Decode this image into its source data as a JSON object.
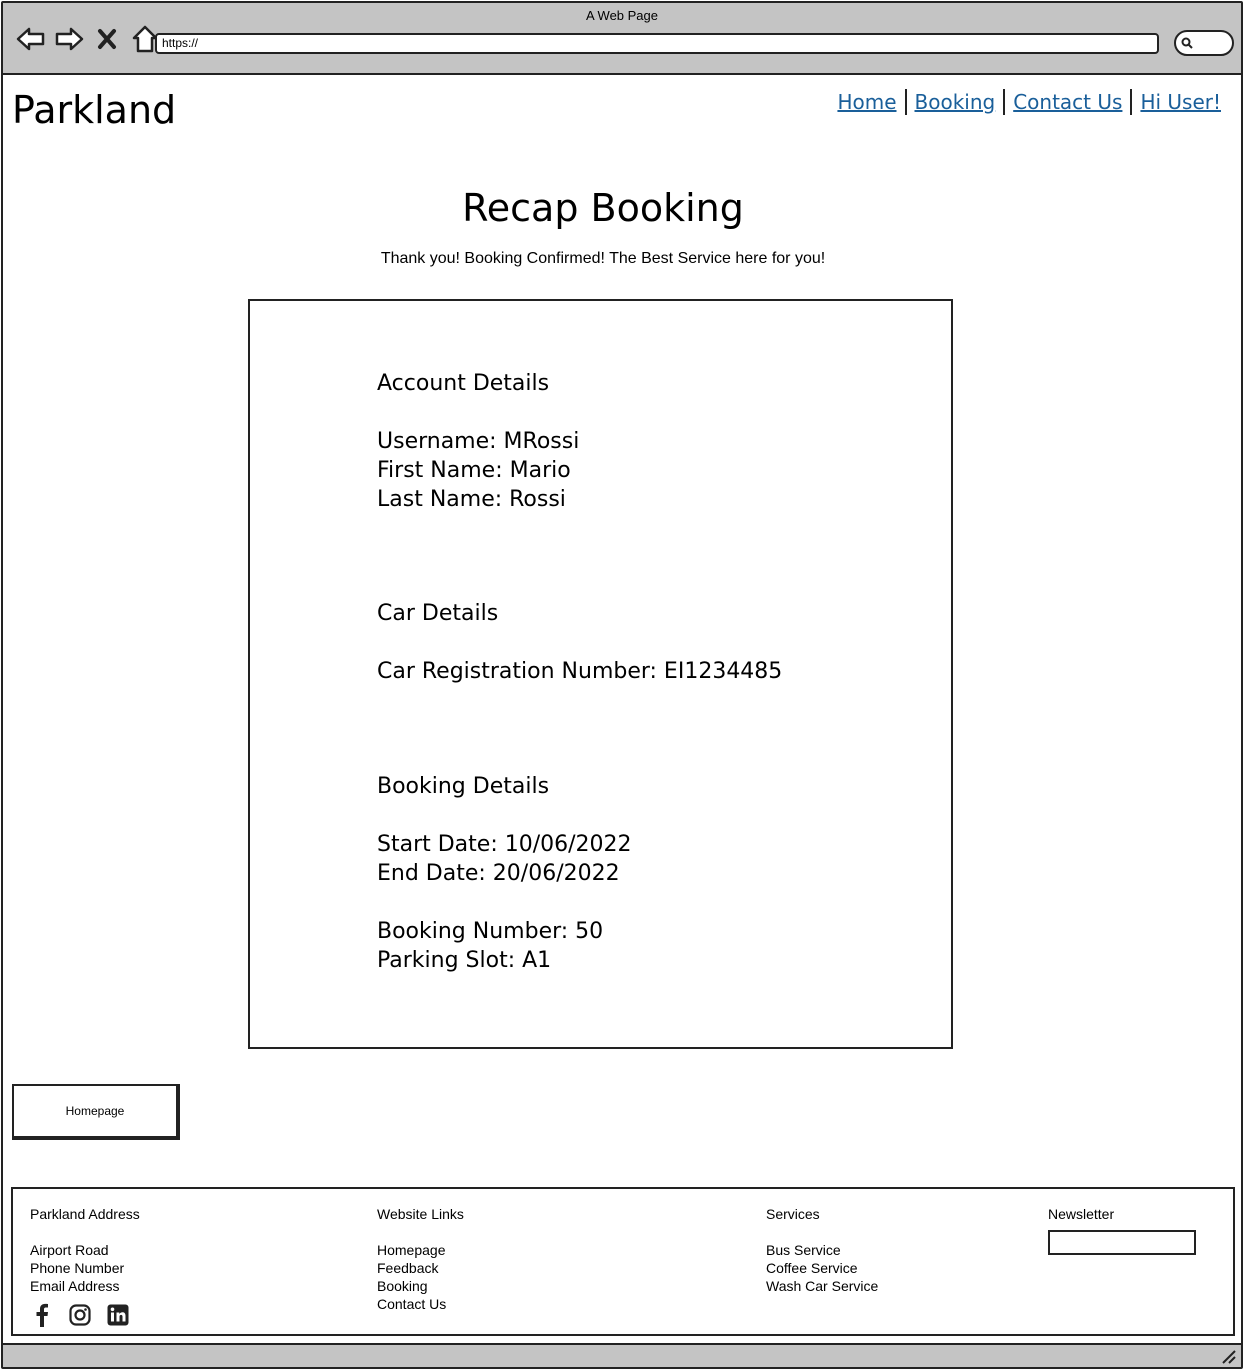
{
  "browser": {
    "title": "A Web Page",
    "url": "https://",
    "icons": [
      "back-arrow-icon",
      "forward-arrow-icon",
      "close-icon",
      "home-icon",
      "search-icon"
    ]
  },
  "header": {
    "logo": "Parkland",
    "nav": [
      "Home",
      "Booking",
      "Contact Us",
      "Hi User!"
    ]
  },
  "main": {
    "title": "Recap Booking",
    "subtitle": "Thank you! Booking Confirmed! The Best Service here for you!",
    "account": {
      "heading": "Account Details",
      "username": "Username: MRossi",
      "first_name": "First Name: Mario",
      "last_name": "Last Name: Rossi"
    },
    "car": {
      "heading": "Car Details",
      "registration": "Car Registration Number: EI1234485"
    },
    "booking": {
      "heading": "Booking Details",
      "start": "Start Date: 10/06/2022",
      "end": "End Date: 20/06/2022",
      "number": "Booking Number: 50",
      "slot": "Parking Slot: A1"
    },
    "homepage_button": "Homepage"
  },
  "footer": {
    "address": {
      "heading": "Parkland Address",
      "lines": [
        "Airport Road",
        "Phone Number",
        "Email Address"
      ],
      "social_icons": [
        "facebook-icon",
        "instagram-icon",
        "linkedin-icon"
      ]
    },
    "links": {
      "heading": "Website Links",
      "items": [
        "Homepage",
        "Feedback",
        "Booking",
        "Contact Us"
      ]
    },
    "services": {
      "heading": "Services",
      "items": [
        "Bus Service",
        "Coffee Service",
        "Wash Car Service"
      ]
    },
    "newsletter": {
      "heading": "Newsletter",
      "value": ""
    }
  }
}
